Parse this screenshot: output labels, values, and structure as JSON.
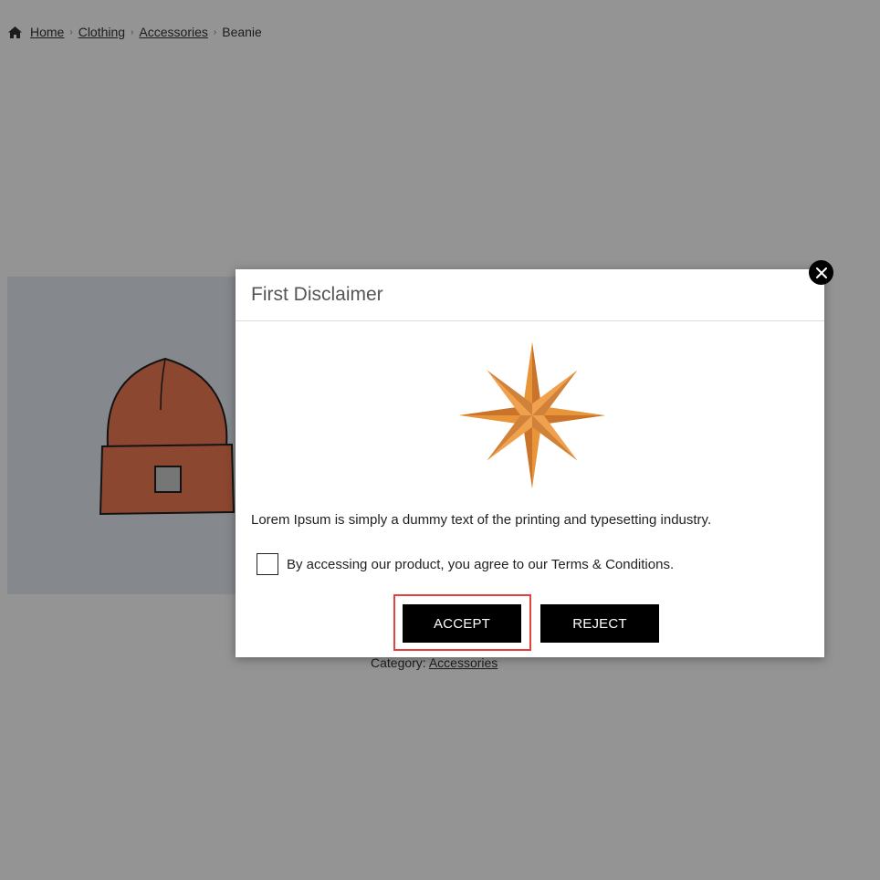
{
  "breadcrumb": {
    "home_icon": "home-icon",
    "items": [
      "Home",
      "Clothing",
      "Accessories",
      "Beanie"
    ],
    "separator": "›"
  },
  "product": {
    "image": "beanie-product-image",
    "category_label": "Category:",
    "category_link": "Accessories"
  },
  "modal": {
    "title": "First Disclaimer",
    "close_icon": "close-icon",
    "image": "star-compass-icon",
    "body_text": "Lorem Ipsum is simply a dummy text of the printing and typesetting industry.",
    "agree_text": "By accessing our product, you agree to our Terms & Conditions.",
    "agree_checked": false,
    "accept_label": "ACCEPT",
    "reject_label": "REJECT",
    "highlight_color": "#e34040"
  },
  "colors": {
    "overlay": "rgba(0,0,0,0.42)",
    "button_bg": "#000000",
    "star_orange": "#e8953a"
  }
}
